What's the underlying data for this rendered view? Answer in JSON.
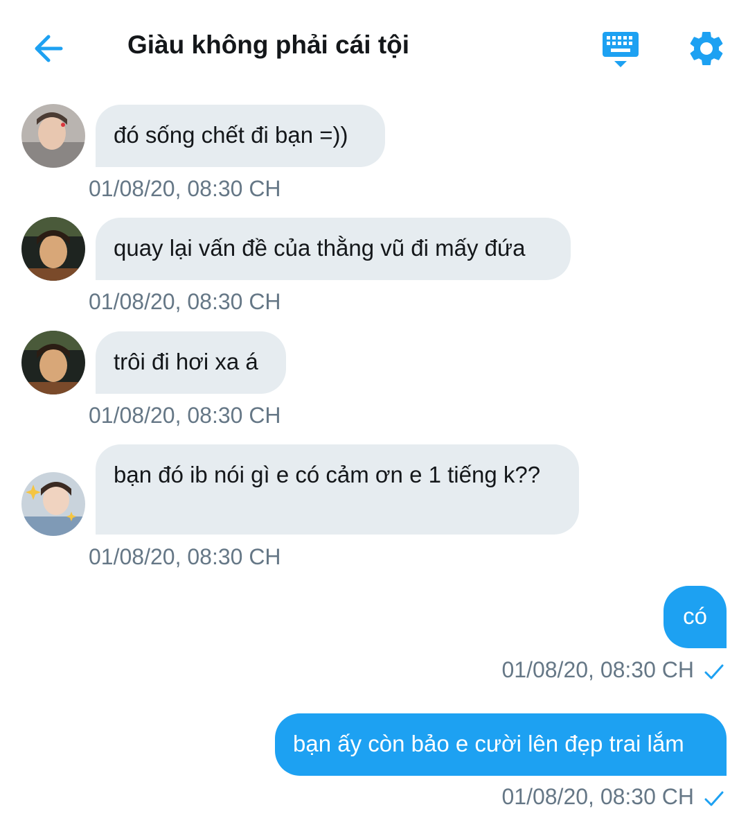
{
  "header": {
    "title": "Giàu không phải cái tội"
  },
  "colors": {
    "accent": "#1da1f2",
    "incoming_bubble": "#e6ecf0",
    "timestamp": "#657786",
    "title": "#14171a"
  },
  "icons": {
    "back": "arrow-left-icon",
    "keyboard": "keyboard-icon",
    "settings": "gear-icon",
    "read": "checkmark-icon"
  },
  "messages": [
    {
      "direction": "incoming",
      "text": "đó sống chết đi bạn =))",
      "time": "01/08/20, 08:30 CH"
    },
    {
      "direction": "incoming",
      "text": "quay lại vấn đề của thằng vũ đi mấy đứa",
      "time": "01/08/20, 08:30 CH"
    },
    {
      "direction": "incoming",
      "text": "trôi đi hơi xa á",
      "time": "01/08/20, 08:30 CH"
    },
    {
      "direction": "incoming",
      "text": "bạn đó ib nói gì e có cảm ơn e 1 tiếng k??",
      "time": "01/08/20, 08:30 CH"
    },
    {
      "direction": "outgoing",
      "text": "có",
      "time": "01/08/20, 08:30 CH"
    },
    {
      "direction": "outgoing",
      "text": "bạn ấy còn bảo e cười lên đẹp trai lắm",
      "time": "01/08/20, 08:30 CH"
    }
  ]
}
